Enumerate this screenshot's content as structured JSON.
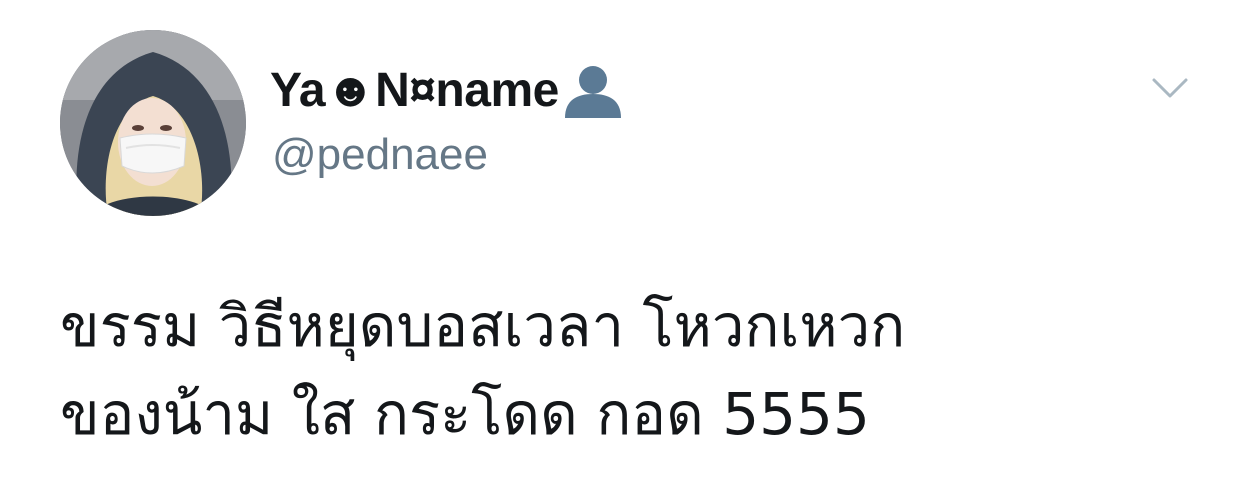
{
  "user": {
    "display_name": "Ya☻N¤name",
    "handle": "@pednaee",
    "avatar": "profile-photo"
  },
  "tweet": {
    "lines": [
      "ขรรม วิธีหยุดบอสเวลา โหวกเหวก",
      "ของน้าม ใส กระโดด กอด 5555"
    ]
  },
  "icons": {
    "name_suffix": "bust-in-silhouette-icon",
    "menu": "chevron-down-icon"
  },
  "colors": {
    "name": "#14171a",
    "handle": "#657786",
    "caret": "#aab8c2",
    "silhouette": "#5b7a95"
  }
}
